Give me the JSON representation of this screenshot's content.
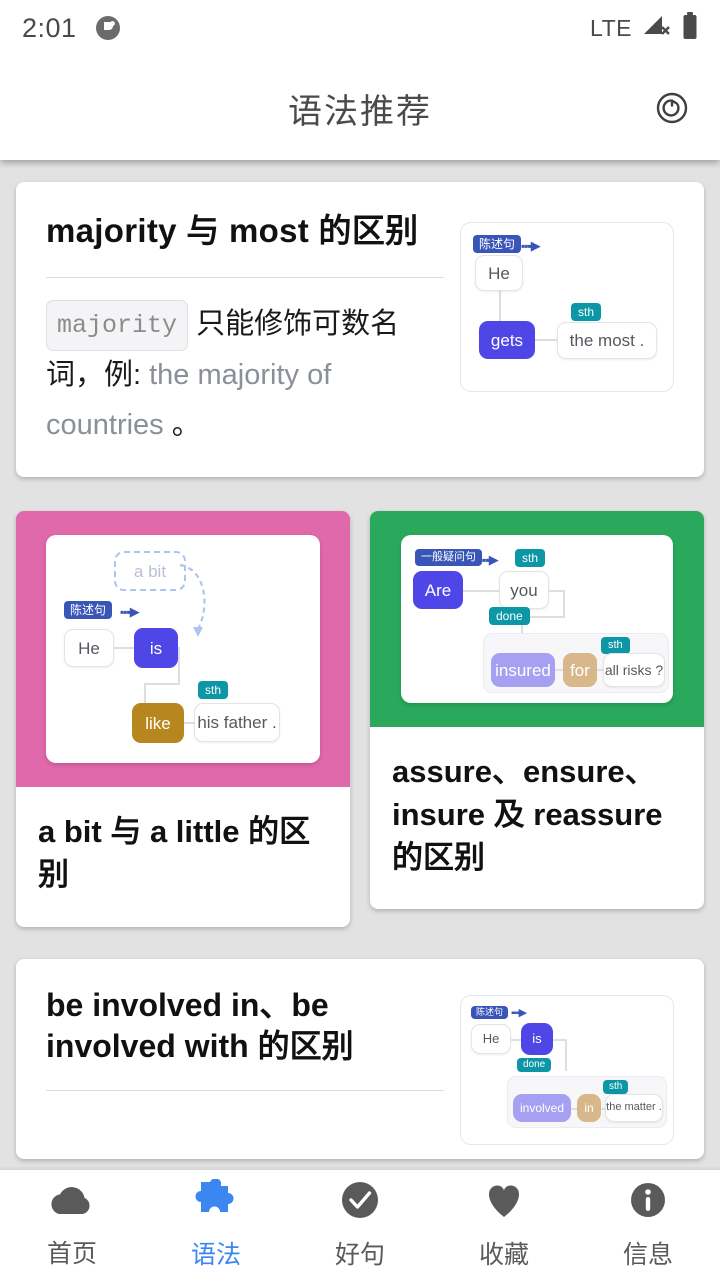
{
  "status_bar": {
    "time": "2:01",
    "app_icon": "app-badge-icon",
    "network": "LTE",
    "signal_icon": "signal-no-data-icon",
    "battery_icon": "battery-full-icon"
  },
  "app_bar": {
    "title": "语法推荐",
    "action_icon": "refresh-icon"
  },
  "cards": [
    {
      "id": "majority-most",
      "title": "majority 与 most 的区别",
      "body": {
        "code": "majority",
        "text_cn_1": " 只能修饰可数名词，例: ",
        "text_en": "the majority of countries",
        "text_cn_2": " 。"
      },
      "diagram": {
        "tag": "陈述句",
        "nodes": [
          "He",
          "gets",
          "the most ."
        ],
        "badges": [
          "sth"
        ]
      }
    },
    {
      "id": "a-bit-a-little",
      "hero_color": "#e069ab",
      "title": "a bit 与 a little 的区别",
      "diagram": {
        "tag": "陈述句",
        "ghost_node": "a bit",
        "nodes": [
          "He",
          "is",
          "like",
          "his father ."
        ],
        "badges": [
          "sth"
        ]
      }
    },
    {
      "id": "assure-ensure-insure-reassure",
      "hero_color": "#2aa95d",
      "title": "assure、ensure、insure 及 reassure 的区别",
      "diagram": {
        "tag": "一般疑问句",
        "nodes": [
          "Are",
          "you",
          "insured",
          "for",
          "all risks ?"
        ],
        "badges": [
          "sth",
          "done",
          "sth"
        ]
      }
    },
    {
      "id": "be-involved-in-with",
      "title": "be involved in、be involved with 的区别",
      "diagram": {
        "tag": "陈述句",
        "nodes": [
          "He",
          "is",
          "involved",
          "in",
          "the matter ."
        ],
        "badges": [
          "done",
          "sth"
        ]
      }
    }
  ],
  "bottom_nav": {
    "items": [
      {
        "label": "首页",
        "icon": "cloud-icon",
        "active": false
      },
      {
        "label": "语法",
        "icon": "puzzle-icon",
        "active": true
      },
      {
        "label": "好句",
        "icon": "check-circle-icon",
        "active": false
      },
      {
        "label": "收藏",
        "icon": "heart-icon",
        "active": false
      },
      {
        "label": "信息",
        "icon": "info-circle-icon",
        "active": false
      }
    ],
    "active_color": "#3b86f0",
    "inactive_color": "#5a5a5a"
  },
  "colors": {
    "page_background": "#e2e2e2",
    "surface": "#ffffff",
    "indigo_node": "#4f46e8",
    "gold_node": "#b8861f",
    "light_purple_node": "#a6a0f2",
    "tan_node": "#d8b78b",
    "teal_badge": "#0d97a6",
    "indigo_badge": "#3a55b8",
    "pink_hero": "#e069ab",
    "green_hero": "#2aa95d"
  }
}
